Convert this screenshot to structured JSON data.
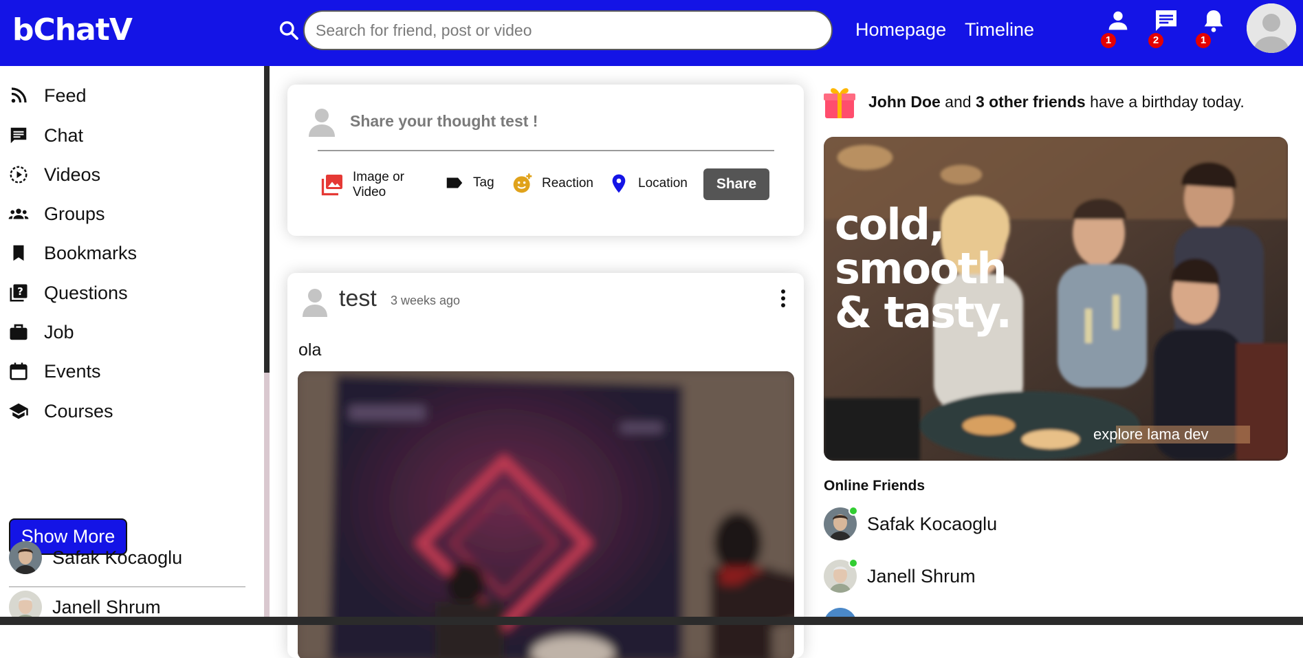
{
  "header": {
    "logo": "bChatV",
    "search_placeholder": "Search for friend, post or video",
    "links": [
      "Homepage",
      "Timeline"
    ],
    "badges": {
      "friends": "1",
      "messages": "2",
      "notifications": "1"
    },
    "brand_color": "#1414e6"
  },
  "sidebar": {
    "items": [
      {
        "label": "Feed",
        "icon": "rss-icon"
      },
      {
        "label": "Chat",
        "icon": "chat-icon"
      },
      {
        "label": "Videos",
        "icon": "play-circle-icon"
      },
      {
        "label": "Groups",
        "icon": "group-icon"
      },
      {
        "label": "Bookmarks",
        "icon": "bookmark-icon"
      },
      {
        "label": "Questions",
        "icon": "help-icon"
      },
      {
        "label": "Job",
        "icon": "briefcase-icon"
      },
      {
        "label": "Events",
        "icon": "calendar-icon"
      },
      {
        "label": "Courses",
        "icon": "school-icon"
      }
    ],
    "show_more": "Show More",
    "friends": [
      "Safak Kocaoglu",
      "Janell Shrum"
    ]
  },
  "share": {
    "prompt": "Share your thought test !",
    "options": [
      {
        "label": "Image or Video",
        "icon": "photo-icon",
        "color": "#e53935"
      },
      {
        "label": "Tag",
        "icon": "label-icon",
        "color": "#111111"
      },
      {
        "label": "Reaction",
        "icon": "emoji-icon",
        "color": "#e0a21b"
      },
      {
        "label": "Location",
        "icon": "location-icon",
        "color": "#1414e6"
      }
    ],
    "button": "Share"
  },
  "post": {
    "username": "test",
    "time": "3 weeks ago",
    "text": "ola"
  },
  "rightbar": {
    "birthday": {
      "name": "John Doe",
      "middle": " and ",
      "others": "3 other friends",
      "suffix": " have a birthday today."
    },
    "ad": {
      "headline_lines": [
        "cold,",
        "smooth",
        "& tasty."
      ],
      "tagline": "explore lama dev"
    },
    "online_title": "Online Friends",
    "online": [
      "Safak Kocaoglu",
      "Janell Shrum"
    ]
  }
}
